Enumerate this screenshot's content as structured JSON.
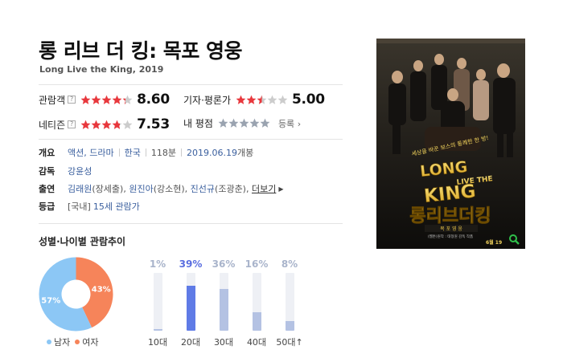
{
  "movie": {
    "title": "롱 리브 더 킹: 목포 영웅",
    "subtitle": "Long Live the King, 2019"
  },
  "ratings": {
    "audience": {
      "label": "관람객",
      "help": "?",
      "score": "8.60",
      "stars": 4.3
    },
    "critics": {
      "label": "기자·평론가",
      "score": "5.00",
      "stars": 2.5
    },
    "netizen": {
      "label": "네티즌",
      "help": "?",
      "score": "7.53",
      "stars": 3.8
    },
    "mine": {
      "label": "내 평점",
      "stars": 0,
      "enroll": "등록"
    }
  },
  "colors": {
    "star_on": "#e8383d",
    "star_off": "#cccccc",
    "mine_star": "#9aa3b0"
  },
  "info": {
    "overview": {
      "label": "개요",
      "genre": "액션, 드라마",
      "country": "한국",
      "runtime": "118분",
      "release_date": "2019.06.19",
      "release_suffix": "개봉"
    },
    "director": {
      "label": "감독",
      "name": "강윤성"
    },
    "cast": {
      "label": "출연",
      "actors": [
        {
          "name": "김래원",
          "role": "(장세출)"
        },
        {
          "name": "원진아",
          "role": "(강소현)"
        },
        {
          "name": "진선규",
          "role": "(조광춘)"
        }
      ],
      "more": "더보기"
    },
    "grade": {
      "label": "등급",
      "country_tag": "[국내]",
      "rating": "15세 관람가"
    }
  },
  "poster": {
    "tagline": "세상을 바꾼 보스의 통쾌한 한 방!",
    "logo_line1": "LONG",
    "logo_line2": "LIVE THE",
    "logo_line3": "KING",
    "title_kr": "롱리브더킹",
    "subtitle_kr": "목 포 영 웅",
    "credit": "(웹툰)원작 : 태형원 감독 작품",
    "release": "6월 19"
  },
  "chart": {
    "title": "성별·나이별 관람추이"
  },
  "chart_data": [
    {
      "type": "pie",
      "categories": [
        "남자",
        "여자"
      ],
      "values": [
        57,
        43
      ],
      "labels": [
        "57%",
        "43%"
      ],
      "colors": [
        "#8cc7f5",
        "#f6845a"
      ]
    },
    {
      "type": "bar",
      "categories": [
        "10대",
        "20대",
        "30대",
        "40대",
        "50대↑"
      ],
      "values": [
        1,
        39,
        36,
        16,
        8
      ],
      "labels": [
        "1%",
        "39%",
        "36%",
        "16%",
        "8%"
      ],
      "highlight_index": 1
    }
  ]
}
